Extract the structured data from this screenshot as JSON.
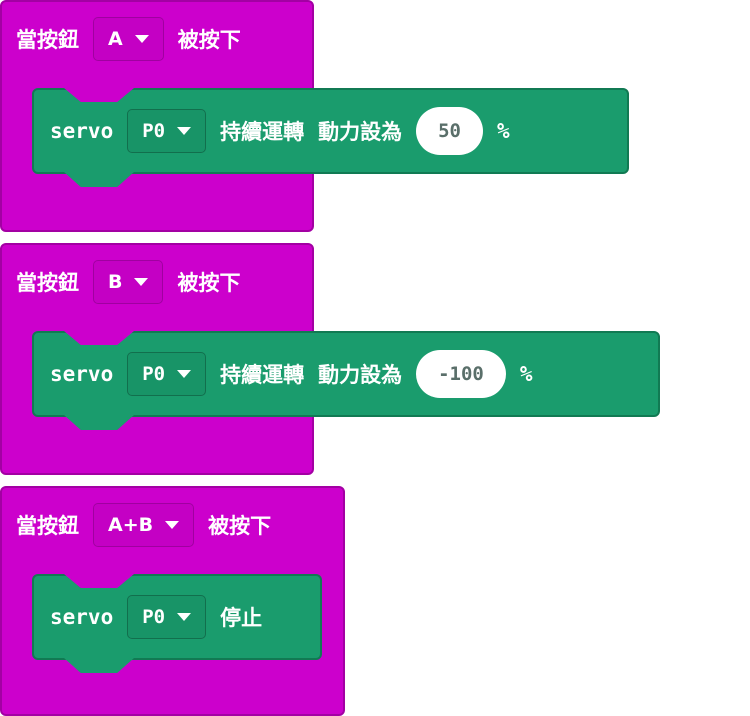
{
  "colors": {
    "event": "#cc00cc",
    "statement": "#1a9c6d",
    "white": "#ffffff"
  },
  "icons": {
    "dropdown": "caret-down-icon"
  },
  "blocks": [
    {
      "event_label": "當按鈕",
      "button": "A",
      "event_suffix": "被按下",
      "statement": {
        "keyword": "servo",
        "pin": "P0",
        "action": "持續運轉",
        "action2": "動力設為",
        "value": "50",
        "unit": "%"
      }
    },
    {
      "event_label": "當按鈕",
      "button": "B",
      "event_suffix": "被按下",
      "statement": {
        "keyword": "servo",
        "pin": "P0",
        "action": "持續運轉",
        "action2": "動力設為",
        "value": "-100",
        "unit": "%"
      }
    },
    {
      "event_label": "當按鈕",
      "button": "A+B",
      "event_suffix": "被按下",
      "statement": {
        "keyword": "servo",
        "pin": "P0",
        "action": "停止"
      }
    }
  ]
}
